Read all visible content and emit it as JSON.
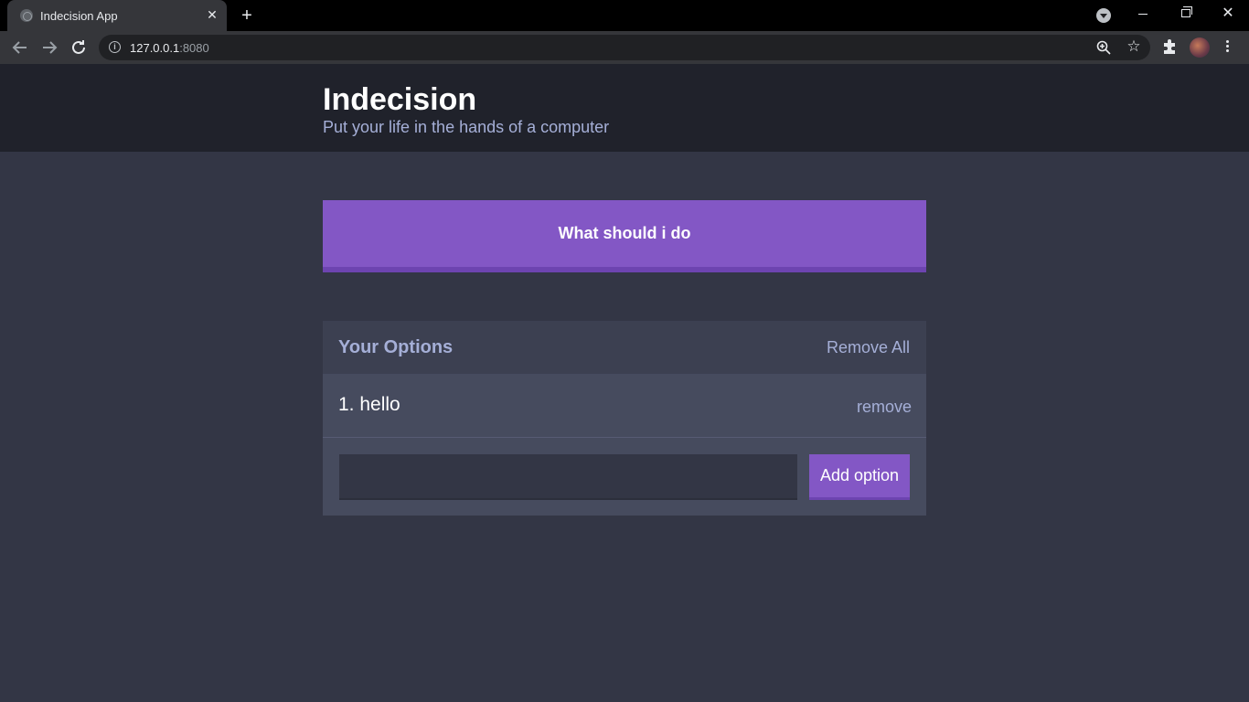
{
  "browser": {
    "tab_title": "Indecision App",
    "url_host": "127.0.0.1",
    "url_port": ":8080",
    "new_tab_glyph": "+",
    "tab_close_glyph": "✕",
    "icons": [
      "globe-favicon-icon",
      "close-icon",
      "plus-icon",
      "tab-search-icon",
      "minimize-icon",
      "maximize-icon",
      "window-close-icon",
      "back-arrow-icon",
      "forward-arrow-icon",
      "reload-icon",
      "info-icon",
      "zoom-icon",
      "star-icon",
      "extensions-icon",
      "avatar",
      "kebab-menu-icon"
    ]
  },
  "app": {
    "title": "Indecision",
    "subtitle": "Put your life in the hands of a computer",
    "decide_button": "What should i do",
    "options_title": "Your Options",
    "remove_all": "Remove All",
    "options": [
      {
        "text": "1. hello",
        "remove_label": "remove"
      }
    ],
    "add_input_value": "",
    "add_button": "Add option"
  },
  "colors": {
    "page_bg": "#333645",
    "header_bg": "#20222b",
    "accent_purple": "#8357c5",
    "accent_purple_dark": "#6d44b0",
    "muted_text": "#a5afd7",
    "widget_bg": "#464b5e",
    "widget_header_bg": "#3c4051"
  }
}
